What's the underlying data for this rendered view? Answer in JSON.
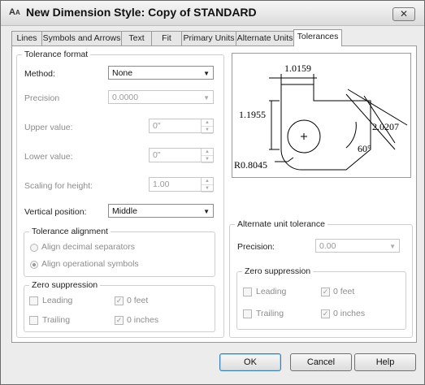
{
  "window": {
    "title": "New Dimension Style: Copy of STANDARD",
    "icon": "autocad-app-icon",
    "close_glyph": "✕"
  },
  "tabs": [
    {
      "label": "Lines"
    },
    {
      "label": "Symbols and Arrows"
    },
    {
      "label": "Text"
    },
    {
      "label": "Fit"
    },
    {
      "label": "Primary Units"
    },
    {
      "label": "Alternate Units"
    },
    {
      "label": "Tolerances",
      "active": true
    }
  ],
  "tolerance_format": {
    "legend": "Tolerance format",
    "method_label": "Method:",
    "method_value": "None",
    "precision_label": "Precision",
    "precision_value": "0.0000",
    "upper_label": "Upper value:",
    "upper_value": "0\"",
    "lower_label": "Lower value:",
    "lower_value": "0\"",
    "scaling_label": "Scaling for height:",
    "scaling_value": "1.00",
    "vertical_label": "Vertical position:",
    "vertical_value": "Middle"
  },
  "tolerance_alignment": {
    "legend": "Tolerance alignment",
    "option1": "Align decimal separators",
    "option2": "Align operational symbols",
    "selected": "option2"
  },
  "zero_suppression_primary": {
    "legend": "Zero suppression",
    "leading": "Leading",
    "trailing": "Trailing",
    "feet": "0 feet",
    "inches": "0 inches",
    "leading_checked": false,
    "trailing_checked": false,
    "feet_checked": true,
    "inches_checked": true
  },
  "preview": {
    "dim_top": "1.0159",
    "dim_left": "1.1955",
    "dim_right": "2.0207",
    "dim_angle": "60°",
    "dim_radius": "R0.8045"
  },
  "alt_unit_tolerance": {
    "legend": "Alternate unit tolerance",
    "precision_label": "Precision:",
    "precision_value": "0.00"
  },
  "zero_suppression_alt": {
    "legend": "Zero suppression",
    "leading": "Leading",
    "trailing": "Trailing",
    "feet": "0 feet",
    "inches": "0 inches",
    "leading_checked": false,
    "trailing_checked": false,
    "feet_checked": true,
    "inches_checked": true
  },
  "buttons": {
    "ok": "OK",
    "cancel": "Cancel",
    "help": "Help"
  },
  "colors": {
    "accent_border": "#3c7fb1",
    "panel_bg": "#ffffff",
    "window_bg": "#ececec"
  }
}
